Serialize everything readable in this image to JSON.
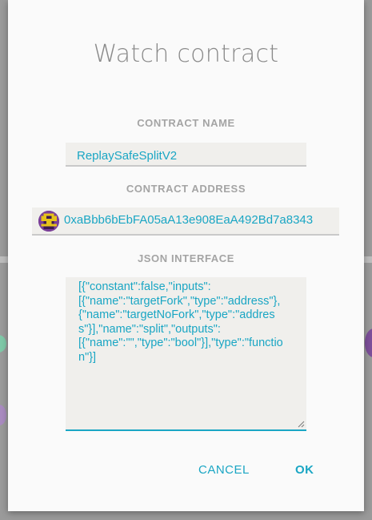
{
  "dialog": {
    "title": "Watch contract",
    "contract_name": {
      "label": "CONTRACT NAME",
      "value": "ReplaySafeSplitV2"
    },
    "contract_address": {
      "label": "CONTRACT ADDRESS",
      "value": "0xaBbb6bEbFA05aA13e908EaA492Bd7a8343"
    },
    "json_interface": {
      "label": "JSON INTERFACE",
      "value": "[{\"constant\":false,\"inputs\":\n[{\"name\":\"targetFork\",\"type\":\"address\"},\n{\"name\":\"targetNoFork\",\"type\":\"address\"}],\"name\":\"split\",\"outputs\":\n[{\"name\":\"\",\"type\":\"bool\"}],\"type\":\"function\"}]"
    },
    "buttons": {
      "cancel_label": "CANCEL",
      "ok_label": "OK"
    }
  },
  "colors": {
    "accent": "#1aa6c4",
    "label_gray": "#a4a4a4",
    "title_gray": "#8a8a8a",
    "identicon_purple": "#7a3f98",
    "identicon_yellow": "#e6c21a"
  },
  "icons": {
    "identicon": "address-identicon",
    "resize": "resize-grip-icon"
  }
}
